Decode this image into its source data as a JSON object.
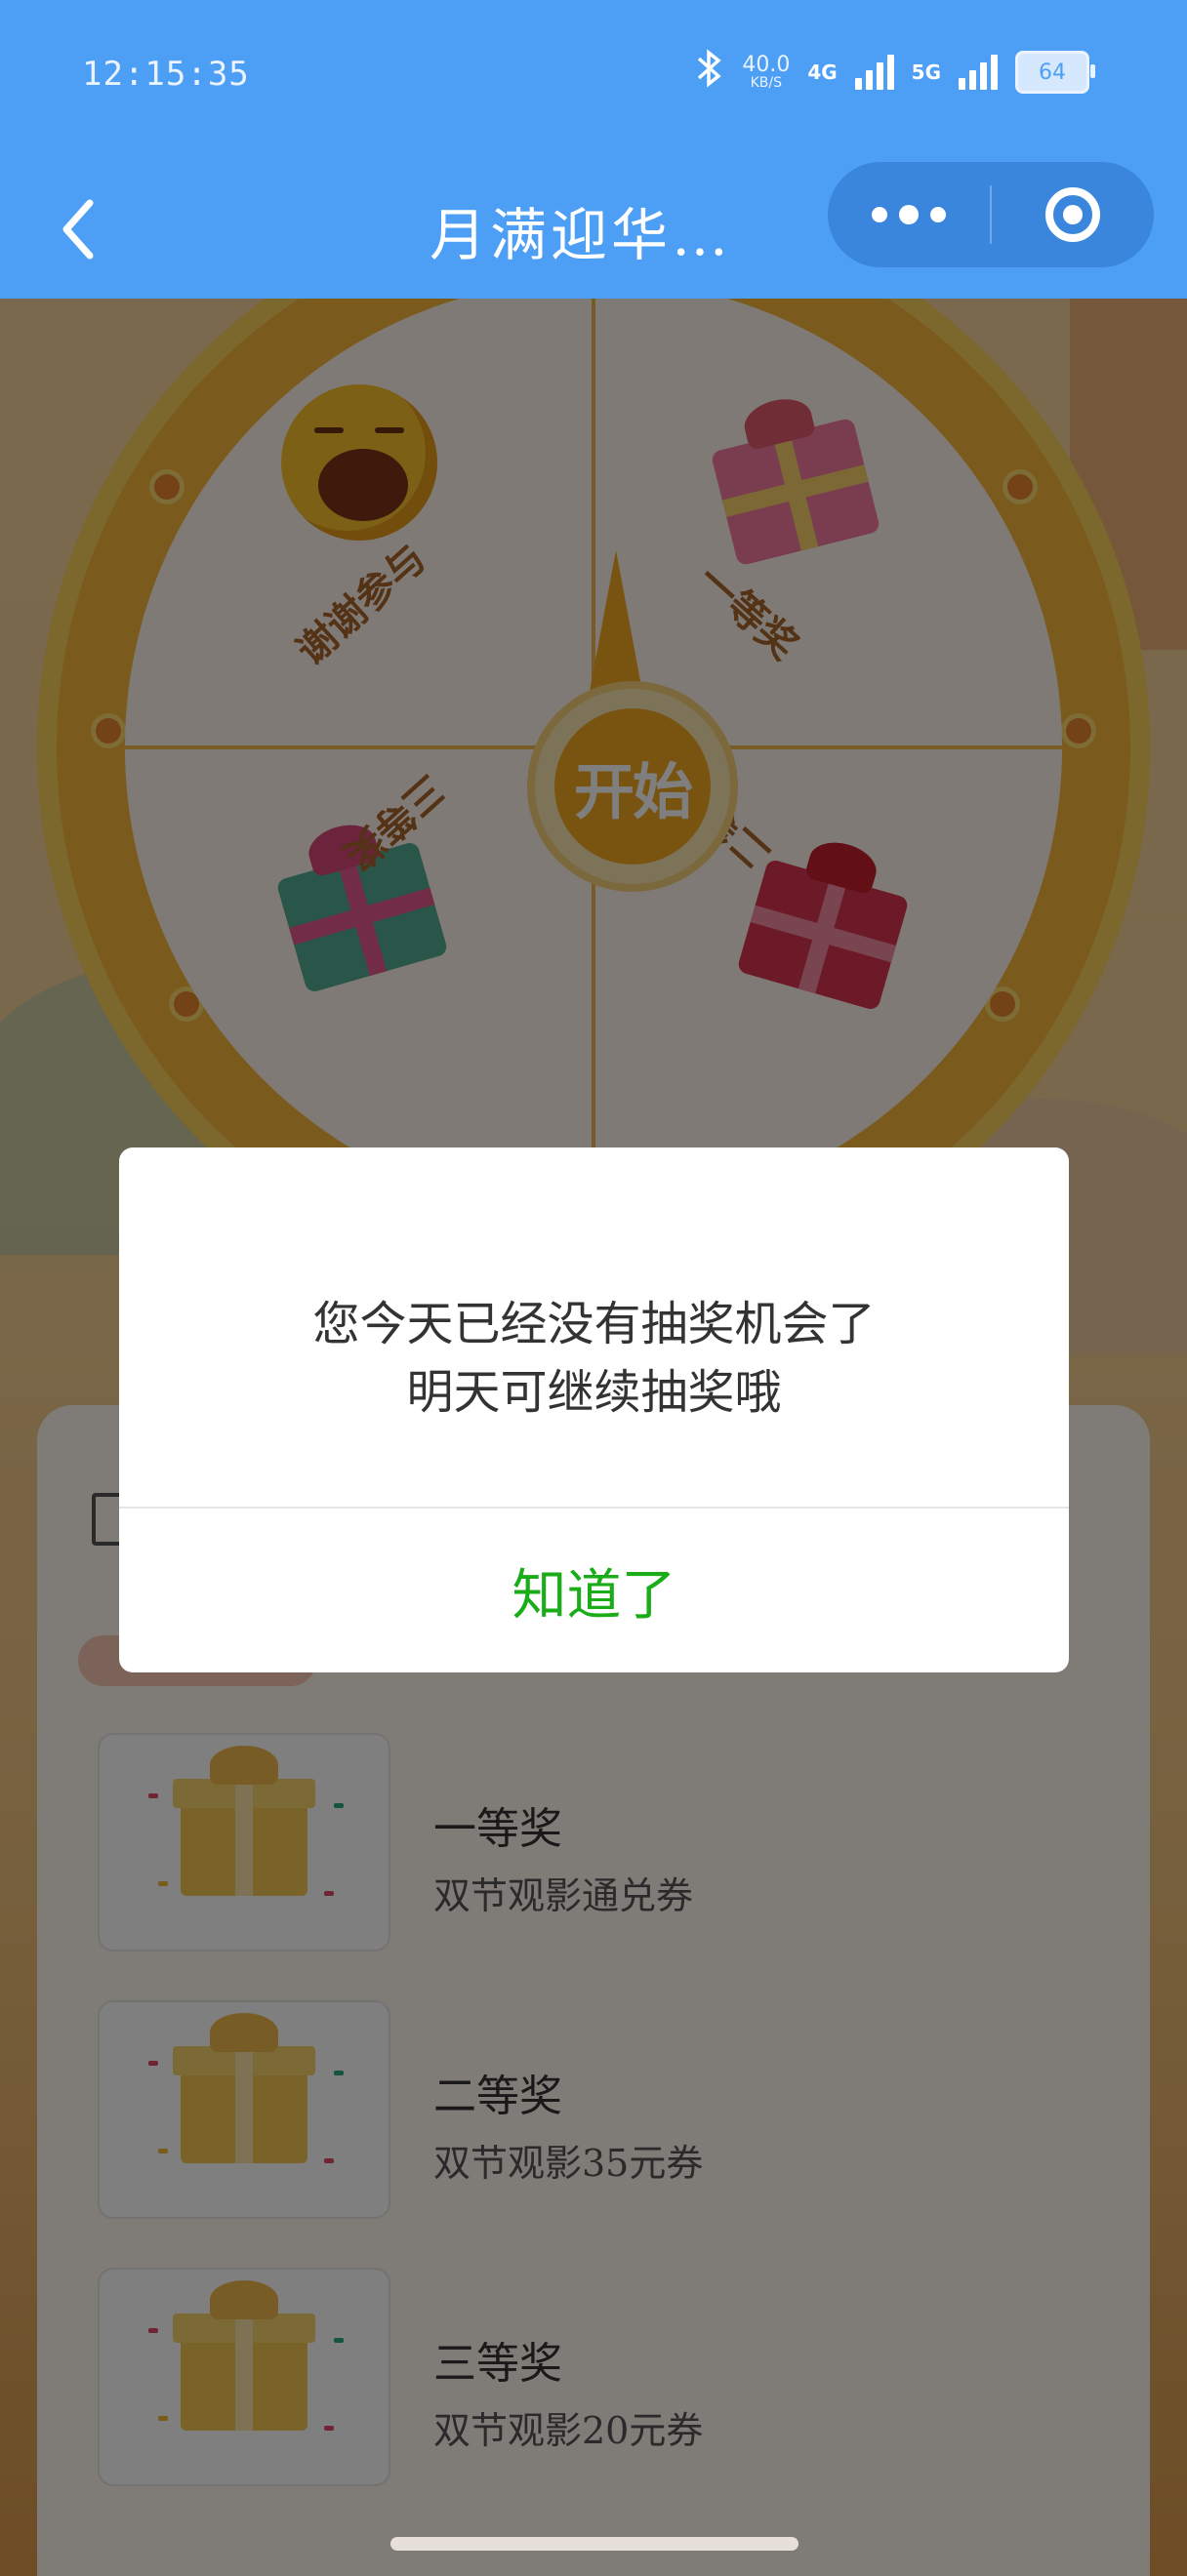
{
  "status_bar": {
    "time": "12:15:35",
    "net_speed_value": "40.0",
    "net_speed_unit": "KB/S",
    "network_4g": "4G",
    "network_5g": "5G",
    "battery": "64"
  },
  "nav": {
    "title": "月满迎华…",
    "back_icon": "chevron-left-icon",
    "more_icon": "more-dots-icon",
    "close_icon": "target-circle-icon"
  },
  "wheel": {
    "start_label": "开始",
    "segments": [
      {
        "label": "谢谢参与",
        "icon": "crying-emoji-icon"
      },
      {
        "label": "一等奖",
        "icon": "pink-gift-icon"
      },
      {
        "label": "三等奖",
        "icon": "green-gift-icon"
      },
      {
        "label": "二等奖",
        "icon": "red-gift-icon"
      }
    ]
  },
  "prizes": [
    {
      "name": "一等奖",
      "desc": "双节观影通兑券"
    },
    {
      "name": "二等奖",
      "desc": "双节观影35元券"
    },
    {
      "name": "三等奖",
      "desc": "双节观影20元券"
    }
  ],
  "dialog": {
    "line1": "您今天已经没有抽奖机会了",
    "line2": "明天可继续抽奖哦",
    "confirm": "知道了"
  },
  "colors": {
    "nav_bg": "#4d9ff6",
    "confirm_text": "#1aad19",
    "wheel_gold": "#f5b73a"
  }
}
